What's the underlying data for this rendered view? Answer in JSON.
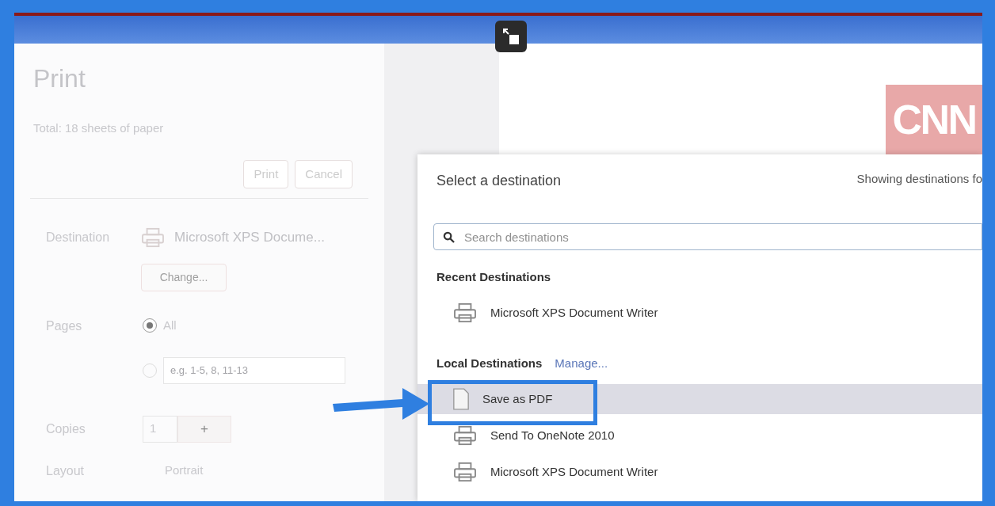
{
  "print_panel": {
    "title": "Print",
    "summary": "Total: 18 sheets of paper",
    "buttons": [
      {
        "label": "Print"
      },
      {
        "label": "Cancel"
      }
    ],
    "destination": {
      "label": "Destination",
      "value": "Microsoft XPS Docume...",
      "change": "Change..."
    },
    "pages": {
      "label": "Pages",
      "options": [
        {
          "kind": "all",
          "label": "All",
          "selected": true
        },
        {
          "kind": "range",
          "placeholder": "e.g. 1-5, 8, 11-13",
          "selected": false
        }
      ]
    },
    "copies": {
      "label": "Copies",
      "value": "1",
      "increment": "+"
    },
    "layout": {
      "label": "Layout",
      "value": "Portrait"
    }
  },
  "preview": {
    "logo": "CNN"
  },
  "destination_dialog": {
    "title": "Select a destination",
    "note": "Showing destinations fo",
    "search": {
      "placeholder": "Search destinations"
    },
    "sections": [
      {
        "heading": "Recent Destinations",
        "items": [
          {
            "kind": "printer",
            "label": "Microsoft XPS Document Writer",
            "selected": false
          }
        ]
      },
      {
        "heading": "Local Destinations",
        "link": "Manage...",
        "items": [
          {
            "kind": "file",
            "label": "Save as PDF",
            "selected": true
          },
          {
            "kind": "printer",
            "label": "Send To OneNote 2010",
            "selected": false
          },
          {
            "kind": "printer",
            "label": "Microsoft XPS Document Writer",
            "selected": false
          }
        ]
      }
    ]
  }
}
